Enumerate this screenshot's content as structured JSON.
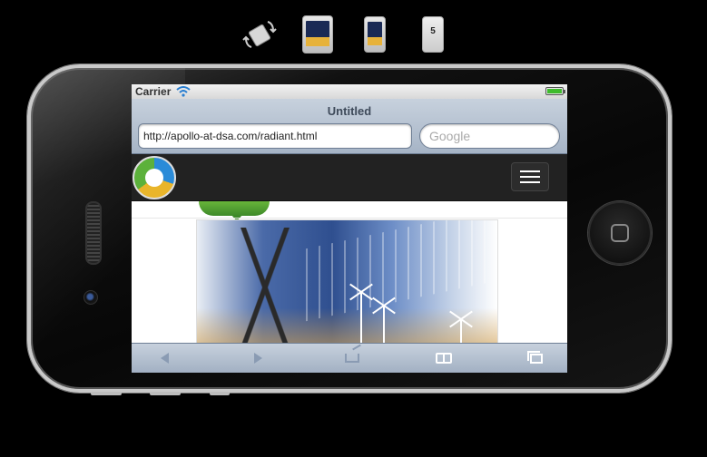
{
  "device_toolbar": {
    "items": [
      {
        "name": "rotate-device",
        "icon": "rotate-icon"
      },
      {
        "name": "ipad",
        "icon": "ipad-icon"
      },
      {
        "name": "iphone-4",
        "icon": "iphone-icon"
      },
      {
        "name": "iphone-5",
        "icon": "iphone5-icon",
        "label": "5"
      }
    ]
  },
  "status_bar": {
    "carrier": "Carrier",
    "wifi_icon": "wifi-icon",
    "battery_level": 1.0,
    "battery_color": "#3fbb2c"
  },
  "browser": {
    "page_title": "Untitled",
    "url": "http://apollo-at-dsa.com/radiant.html",
    "search_placeholder": "Google"
  },
  "site": {
    "logo_icon": "company-logo",
    "menu_icon": "hamburger-icon",
    "hero_image": "power-lines-and-wind-turbines-photo"
  },
  "bottom_toolbar": {
    "items": [
      {
        "name": "back",
        "icon": "back-arrow-icon",
        "enabled": false
      },
      {
        "name": "forward",
        "icon": "forward-arrow-icon",
        "enabled": false
      },
      {
        "name": "share",
        "icon": "share-icon",
        "enabled": false
      },
      {
        "name": "bookmarks",
        "icon": "bookmarks-icon",
        "enabled": true
      },
      {
        "name": "tabs",
        "icon": "tabs-icon",
        "enabled": true
      }
    ]
  }
}
